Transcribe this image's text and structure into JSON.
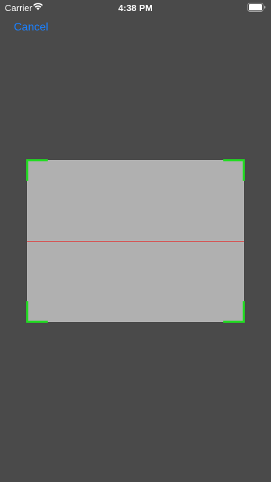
{
  "status_bar": {
    "carrier": "Carrier",
    "time": "4:38 PM",
    "wifi_icon": "wifi-icon",
    "battery_icon": "battery-icon",
    "battery_level": 1.0
  },
  "navigation": {
    "cancel_label": "Cancel"
  },
  "scanner": {
    "frame_color": "#b0b0b0",
    "corner_color": "#22dd22",
    "scan_line_color": "#d94a4a",
    "background_color": "#4a4a4a"
  }
}
